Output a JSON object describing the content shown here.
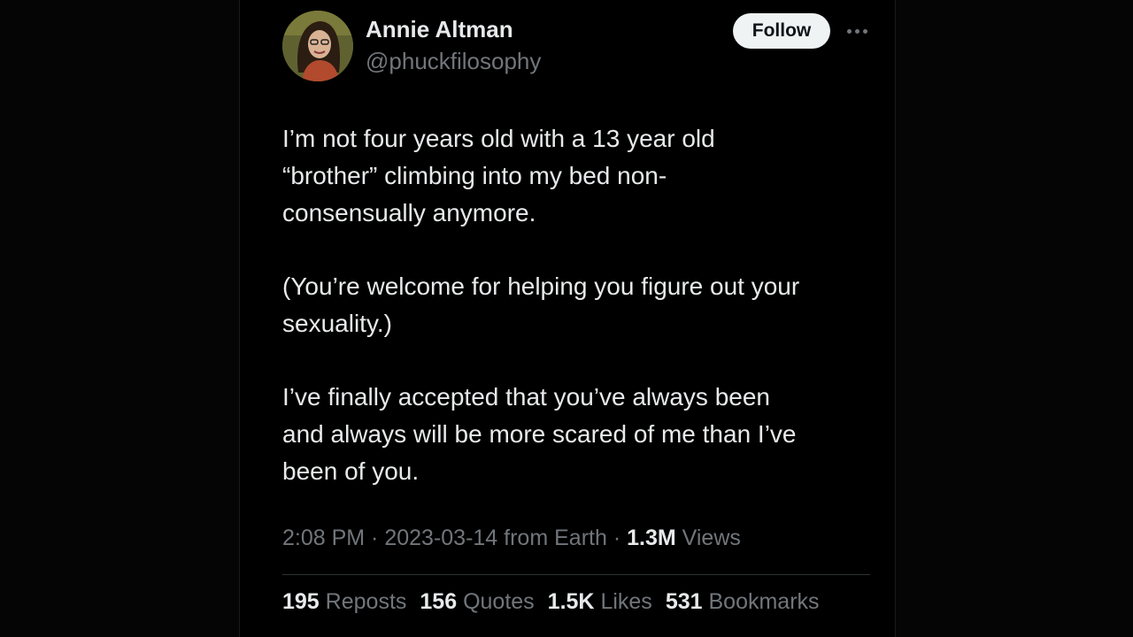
{
  "author": {
    "name": "Annie Altman",
    "handle": "@phuckfilosophy"
  },
  "actions": {
    "follow_label": "Follow",
    "more_icon": "more-horizontal-icon"
  },
  "tweet": {
    "paragraphs": [
      "I’m not four years old with a 13 year old\n“brother” climbing into my bed non-\nconsensually anymore.",
      "(You’re welcome for helping you figure out your\nsexuality.)",
      "I’ve finally accepted that you’ve always been\nand always will be more scared of me than I’ve\nbeen of you."
    ]
  },
  "meta": {
    "time": "2:08 PM",
    "sep1": " · ",
    "date": "2023-03-14",
    "source": " from Earth",
    "sep2": " · ",
    "views_count": "1.3M",
    "views_label": " Views"
  },
  "stats": [
    {
      "count": "195",
      "label": "Reposts"
    },
    {
      "count": "156",
      "label": "Quotes"
    },
    {
      "count": "1.5K",
      "label": "Likes"
    },
    {
      "count": "531",
      "label": "Bookmarks"
    }
  ],
  "colors": {
    "background": "#000000",
    "text_primary": "#e7e9ea",
    "text_secondary": "#71767b",
    "follow_bg": "#eff3f4",
    "divider": "#2f3336"
  }
}
